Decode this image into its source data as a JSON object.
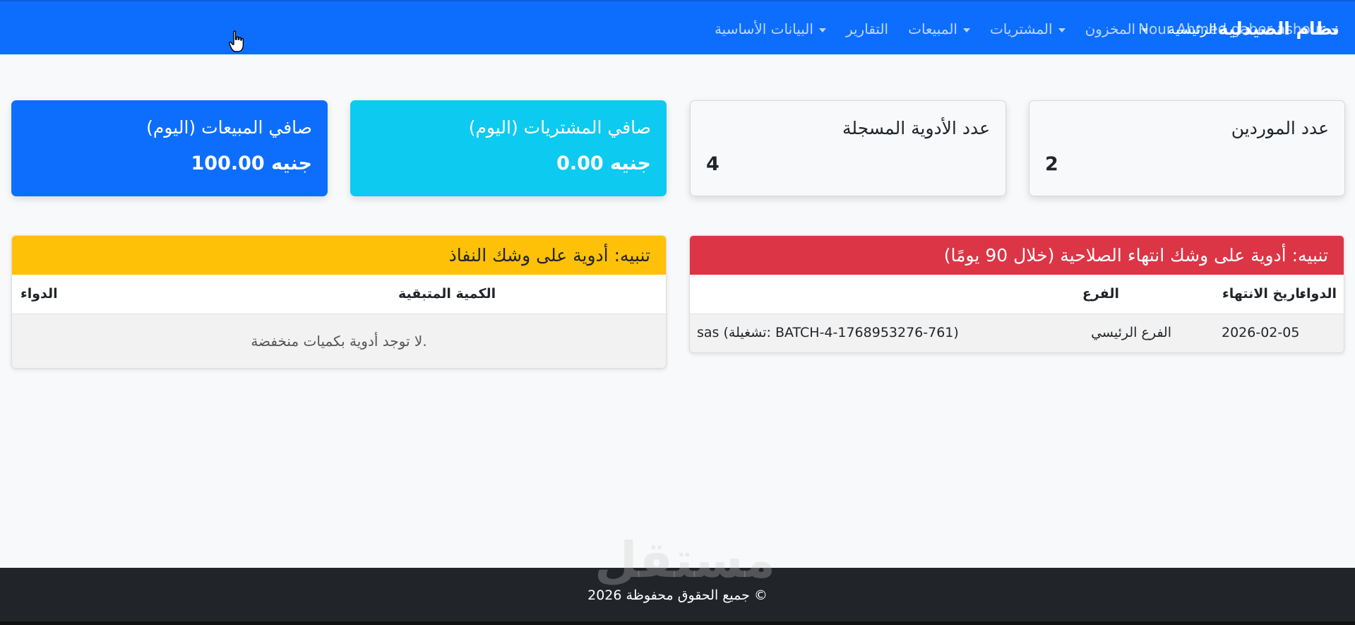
{
  "navbar": {
    "brand": "نظام الصيدلية",
    "items": [
      {
        "label": "الرئيسية",
        "dropdown": false
      },
      {
        "label": "المخزون",
        "dropdown": true
      },
      {
        "label": "المشتريات",
        "dropdown": true
      },
      {
        "label": "المبيعات",
        "dropdown": true
      },
      {
        "label": "التقارير",
        "dropdown": false
      },
      {
        "label": "البيانات الأساسية",
        "dropdown": true
      }
    ],
    "user": "Nour Ahmed gaber ashour"
  },
  "stats": {
    "sales": {
      "title": "صافي المبيعات (اليوم)",
      "value": "100.00 جنيه"
    },
    "purchases": {
      "title": "صافي المشتريات (اليوم)",
      "value": "0.00 جنيه"
    },
    "medicines": {
      "title": "عدد الأدوية المسجلة",
      "value": "4"
    },
    "suppliers": {
      "title": "عدد الموردين",
      "value": "2"
    }
  },
  "expiry_alert": {
    "title": "تنبيه: أدوية على وشك انتهاء الصلاحية (خلال 90 يومًا)",
    "columns": {
      "medicine": "الدواء",
      "branch": "الفرع",
      "expiry": "تاريخ الانتهاء"
    },
    "rows": [
      {
        "medicine": "sas (تشغيلة: BATCH-4-1768953276-761)",
        "branch": "الفرع الرئيسي",
        "expiry": "2026-02-05"
      }
    ]
  },
  "stock_alert": {
    "title": "تنبيه: أدوية على وشك النفاذ",
    "columns": {
      "medicine": "الدواء",
      "remaining": "الكمية المتبقية"
    },
    "empty_message": "لا توجد أدوية بكميات منخفضة."
  },
  "footer": {
    "text": "جميع الحقوق محفوظة 2026 ©"
  },
  "watermark": "مستقل",
  "colors": {
    "primary": "#0d6efd",
    "info": "#0dcaf0",
    "danger": "#dc3545",
    "warning": "#ffc107",
    "dark": "#212529"
  }
}
